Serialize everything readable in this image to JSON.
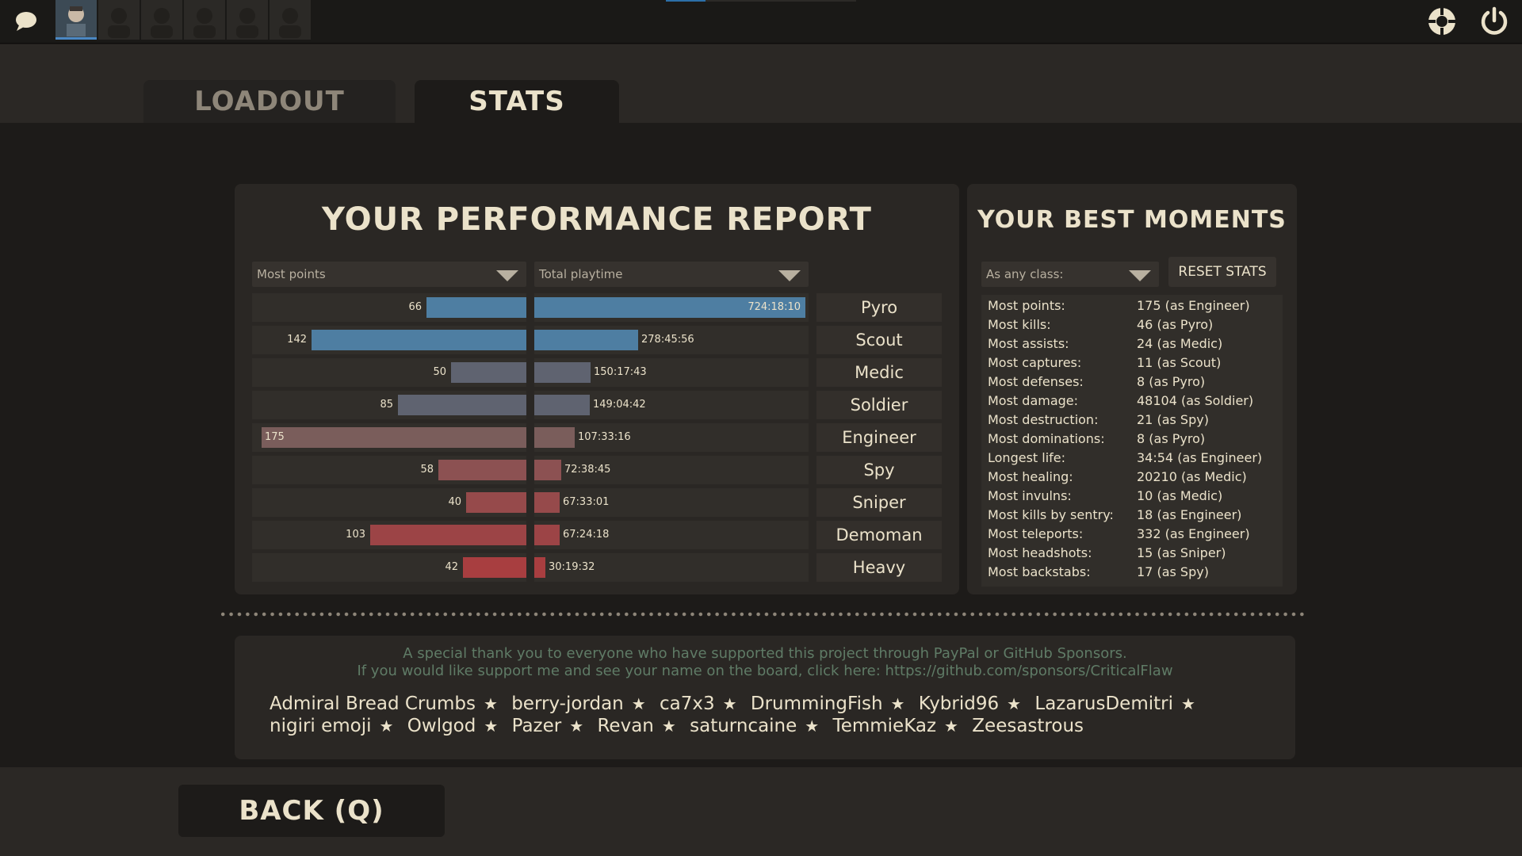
{
  "tabs": {
    "loadout": "LOADOUT",
    "stats": "STATS"
  },
  "performance": {
    "title": "YOUR PERFORMANCE REPORT",
    "points_dropdown": "Most points",
    "playtime_dropdown": "Total playtime",
    "rows": [
      {
        "class": "Pyro",
        "points": 66,
        "points_label": "66",
        "playtime_fraction": 1.0,
        "playtime": "724:18:10",
        "color": "#4e7ea2"
      },
      {
        "class": "Scout",
        "points": 142,
        "points_label": "142",
        "playtime_fraction": 0.384,
        "playtime": "278:45:56",
        "color": "#4e7ea2"
      },
      {
        "class": "Medic",
        "points": 50,
        "points_label": "50",
        "playtime_fraction": 0.207,
        "playtime": "150:17:43",
        "color": "#5f6370"
      },
      {
        "class": "Soldier",
        "points": 85,
        "points_label": "85",
        "playtime_fraction": 0.206,
        "playtime": "149:04:42",
        "color": "#5f6370"
      },
      {
        "class": "Engineer",
        "points": 175,
        "points_label": "175",
        "playtime_fraction": 0.148,
        "playtime": "107:33:16",
        "color": "#7a5d5b"
      },
      {
        "class": "Spy",
        "points": 58,
        "points_label": "58",
        "playtime_fraction": 0.1,
        "playtime": "72:38:45",
        "color": "#8c5152"
      },
      {
        "class": "Sniper",
        "points": 40,
        "points_label": "40",
        "playtime_fraction": 0.093,
        "playtime": "67:33:01",
        "color": "#964a4b"
      },
      {
        "class": "Demoman",
        "points": 103,
        "points_label": "103",
        "playtime_fraction": 0.093,
        "playtime": "67:24:18",
        "color": "#9c4446"
      },
      {
        "class": "Heavy",
        "points": 42,
        "points_label": "42",
        "playtime_fraction": 0.042,
        "playtime": "30:19:32",
        "color": "#a83e40"
      }
    ]
  },
  "moments": {
    "title": "YOUR BEST MOMENTS",
    "class_dropdown": "As any class:",
    "reset_label": "RESET STATS",
    "items": [
      {
        "k": "Most points:",
        "v": "175 (as Engineer)"
      },
      {
        "k": "Most kills:",
        "v": "46 (as Pyro)"
      },
      {
        "k": "Most assists:",
        "v": "24 (as Medic)"
      },
      {
        "k": "Most captures:",
        "v": "11 (as Scout)"
      },
      {
        "k": "Most defenses:",
        "v": "8 (as Pyro)"
      },
      {
        "k": "Most damage:",
        "v": "48104 (as Soldier)"
      },
      {
        "k": "Most destruction:",
        "v": "21 (as Spy)"
      },
      {
        "k": "Most dominations:",
        "v": "8 (as Pyro)"
      },
      {
        "k": "Longest life:",
        "v": "34:54 (as Engineer)"
      },
      {
        "k": "Most healing:",
        "v": "20210 (as Medic)"
      },
      {
        "k": "Most invulns:",
        "v": "10 (as Medic)"
      },
      {
        "k": "Most kills by sentry:",
        "v": "18 (as Engineer)"
      },
      {
        "k": "Most teleports:",
        "v": "332 (as Engineer)"
      },
      {
        "k": "Most headshots:",
        "v": "15 (as Sniper)"
      },
      {
        "k": "Most backstabs:",
        "v": "17 (as Spy)"
      }
    ]
  },
  "thanks": {
    "line1": "A special thank you to everyone who have supported this project through PayPal or GitHub Sponsors.",
    "line2": "If you would like support me and see your name on the board, click here: https://github.com/sponsors/CriticalFlaw",
    "supporters": [
      "Admiral Bread Crumbs",
      "berry-jordan",
      "ca7x3",
      "DrummingFish",
      "Kybrid96",
      "LazarusDemitri",
      "nigiri emoji",
      "Owlgod",
      "Pazer",
      "Revan",
      "saturncaine",
      "TemmieKaz",
      "Zeesastrous"
    ]
  },
  "back_label": "BACK (Q)",
  "icons": {
    "chat": "chat-bubble-icon",
    "settings": "settings-icon",
    "power": "power-icon"
  }
}
